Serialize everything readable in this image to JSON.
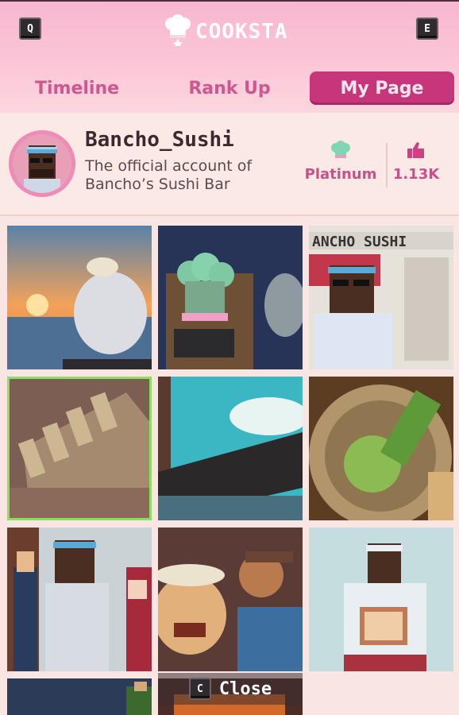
{
  "header": {
    "left_key": "Q",
    "right_key": "E",
    "logo_text": "COOKSTA",
    "logo_icon": "chef-hat-icon",
    "tabs": [
      {
        "label": "Timeline",
        "active": false
      },
      {
        "label": "Rank Up",
        "active": false
      },
      {
        "label": "My Page",
        "active": true
      }
    ]
  },
  "profile": {
    "username": "Bancho_Sushi",
    "bio_line1": "The official account of",
    "bio_line2": "Bancho’s Sushi Bar",
    "rank_icon": "chef-hat-icon",
    "rank_label": "Platinum",
    "likes_icon": "thumbs-up-icon",
    "likes_label": "1.13K"
  },
  "posts": [
    {
      "name": "post-sunset-chef"
    },
    {
      "name": "post-trophy"
    },
    {
      "name": "post-newspaper"
    },
    {
      "name": "post-recipe-cards"
    },
    {
      "name": "post-motion-blur"
    },
    {
      "name": "post-wasabi-basket"
    },
    {
      "name": "post-group-photo"
    },
    {
      "name": "post-crowd-cheer"
    },
    {
      "name": "post-certificate"
    },
    {
      "name": "post-partial-1"
    },
    {
      "name": "post-partial-2"
    }
  ],
  "footer": {
    "close_key": "C",
    "close_label": "Close"
  },
  "colors": {
    "accent": "#c7367a",
    "tab_text": "#d0568e",
    "header_bg": "#f8b6cf",
    "page_bg": "#f9e6e3",
    "selection": "#8be060"
  }
}
